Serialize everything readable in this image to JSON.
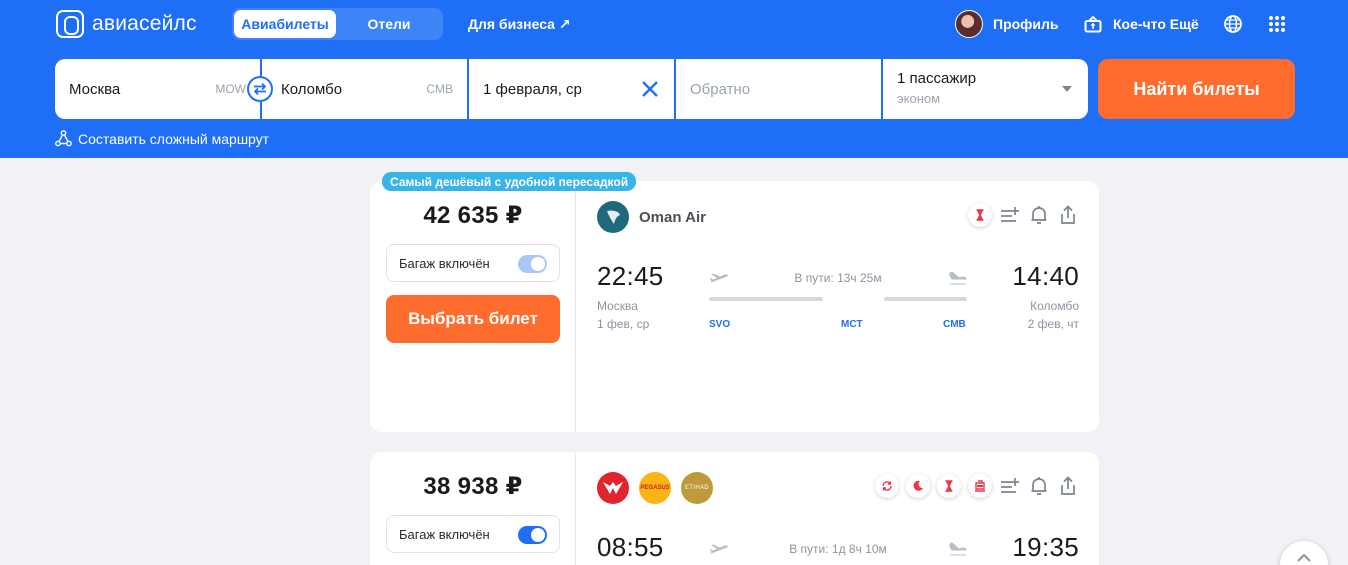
{
  "brand": {
    "name": "авиасейлс"
  },
  "nav": {
    "tabs": [
      {
        "label": "Авиабилеты",
        "active": true
      },
      {
        "label": "Отели",
        "active": false
      }
    ],
    "business": "Для бизнеса ↗",
    "profile": "Профиль",
    "more": "Кое-что Ещё"
  },
  "search": {
    "origin": "Москва",
    "origin_code": "MOW",
    "destination": "Коломбо",
    "destination_code": "CMB",
    "depart_date": "1 февраля, ср",
    "return_placeholder": "Обратно",
    "passengers": "1 пассажир",
    "cabin": "эконом",
    "find_label": "Найти билеты",
    "complex_route": "Составить сложный маршрут"
  },
  "results": [
    {
      "badge": "Самый дешёвый с удобной пересадкой",
      "price": "42 635 ₽",
      "baggage_label": "Багаж включён",
      "baggage_on": false,
      "select_label": "Выбрать билет",
      "airline": "Oman Air",
      "depart_time": "22:45",
      "depart_city": "Москва",
      "depart_date": "1 фев, ср",
      "arrive_time": "14:40",
      "arrive_city": "Коломбо",
      "arrive_date": "2 фев, чт",
      "duration": "В пути: 13ч 25м",
      "airports": [
        "SVO",
        "MCT",
        "CMB"
      ]
    },
    {
      "price": "38 938 ₽",
      "baggage_label": "Багаж включён",
      "baggage_on": true,
      "airline_logos": [
        "flyone-logo",
        "pegasus-logo",
        "etihad-logo"
      ],
      "pegasus_text": "PEGASUS",
      "etihad_text": "ETIHAD",
      "depart_time": "08:55",
      "arrive_time": "19:35",
      "duration": "В пути: 1д 8ч 10м"
    }
  ],
  "colors": {
    "brand_blue": "#1e6ff5",
    "cta_orange": "#ff6d2e",
    "badge_cyan": "#39b4e8"
  }
}
